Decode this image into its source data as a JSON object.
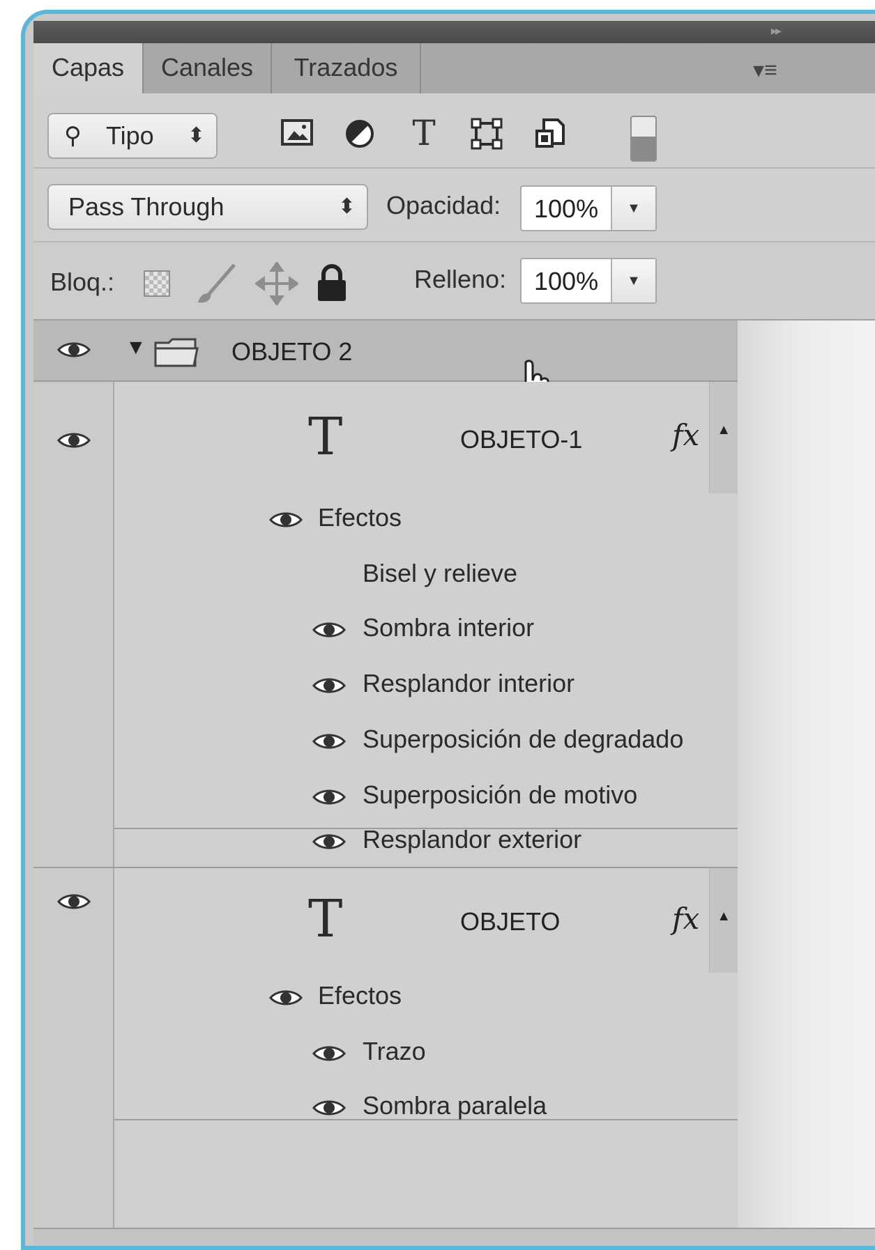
{
  "tabs": [
    {
      "label": "Capas",
      "active": true
    },
    {
      "label": "Canales",
      "active": false
    },
    {
      "label": "Trazados",
      "active": false
    }
  ],
  "filter": {
    "kind_label": "Tipo",
    "icons": [
      "image-filter-icon",
      "adjustment-filter-icon",
      "type-filter-icon",
      "shape-filter-icon",
      "smart-object-filter-icon"
    ]
  },
  "blend": {
    "mode": "Pass Through",
    "opacity_label": "Opacidad:",
    "opacity_value": "100%"
  },
  "lock": {
    "label": "Bloq.:",
    "fill_label": "Relleno:",
    "fill_value": "100%"
  },
  "group": {
    "name": "OBJETO 2"
  },
  "layers": [
    {
      "name": "OBJETO-1",
      "fx": "fx",
      "effects_label": "Efectos",
      "effects": [
        {
          "name": "Bisel y relieve",
          "visible": false
        },
        {
          "name": "Sombra interior",
          "visible": true
        },
        {
          "name": "Resplandor interior",
          "visible": true
        },
        {
          "name": "Superposición de degradado",
          "visible": true
        },
        {
          "name": "Superposición de motivo",
          "visible": true
        },
        {
          "name": "Resplandor exterior",
          "visible": true
        }
      ]
    },
    {
      "name": "OBJETO",
      "fx": "fx",
      "effects_label": "Efectos",
      "effects": [
        {
          "name": "Trazo",
          "visible": true
        },
        {
          "name": "Sombra paralela",
          "visible": true
        }
      ]
    }
  ],
  "colors": {
    "frame_border": "#5bb6d8",
    "panel_bg": "#cacaca"
  }
}
